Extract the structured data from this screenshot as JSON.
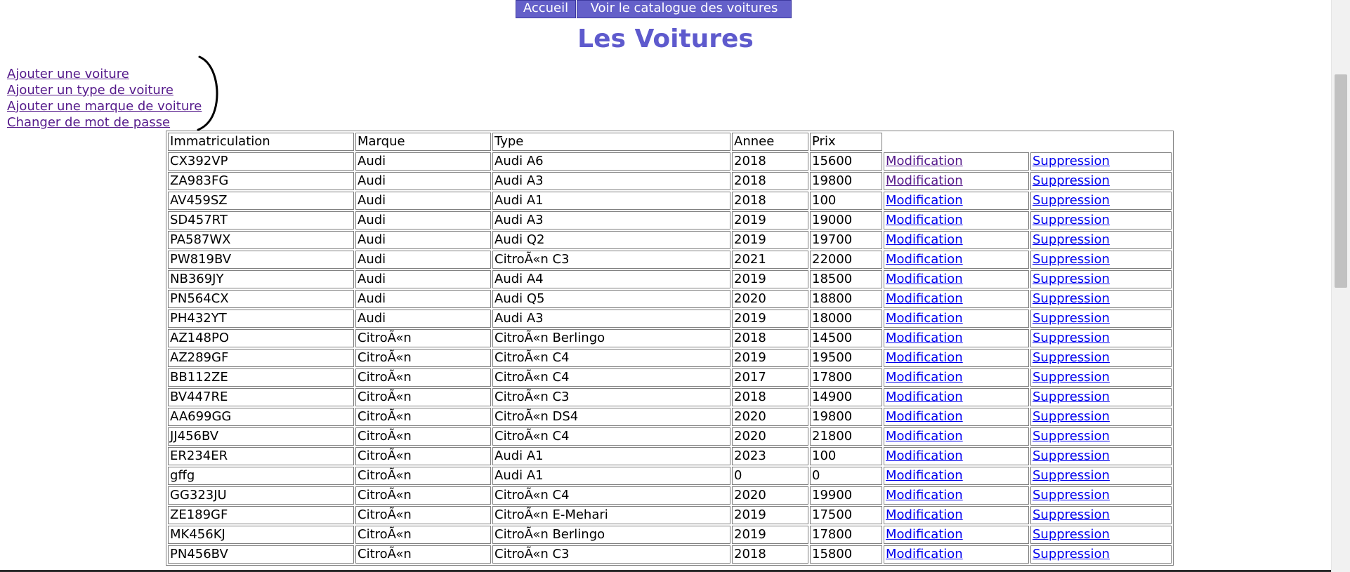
{
  "nav": {
    "home_label": "Accueil",
    "catalog_label": "Voir le catalogue des voitures"
  },
  "page_title": "Les Voitures",
  "links": {
    "add_car": "Ajouter une voiture",
    "add_type": "Ajouter un type de voiture",
    "add_brand": "Ajouter une marque de voiture",
    "change_password": "Changer de mot de passe"
  },
  "table": {
    "headers": [
      "Immatriculation",
      "Marque",
      "Type",
      "Annee",
      "Prix"
    ],
    "edit_label": "Modification",
    "delete_label": "Suppression",
    "rows": [
      [
        "CX392VP",
        "Audi",
        "Audi A6",
        "2018",
        "15600"
      ],
      [
        "ZA983FG",
        "Audi",
        "Audi A3",
        "2018",
        "19800"
      ],
      [
        "AV459SZ",
        "Audi",
        "Audi A1",
        "2018",
        "100"
      ],
      [
        "SD457RT",
        "Audi",
        "Audi A3",
        "2019",
        "19000"
      ],
      [
        "PA587WX",
        "Audi",
        "Audi Q2",
        "2019",
        "19700"
      ],
      [
        "PW819BV",
        "Audi",
        "CitroÃ«n C3",
        "2021",
        "22000"
      ],
      [
        "NB369JY",
        "Audi",
        "Audi A4",
        "2019",
        "18500"
      ],
      [
        "PN564CX",
        "Audi",
        "Audi Q5",
        "2020",
        "18800"
      ],
      [
        "PH432YT",
        "Audi",
        "Audi A3",
        "2019",
        "18000"
      ],
      [
        "AZ148PO",
        "CitroÃ«n",
        "CitroÃ«n Berlingo",
        "2018",
        "14500"
      ],
      [
        "AZ289GF",
        "CitroÃ«n",
        "CitroÃ«n C4",
        "2019",
        "19500"
      ],
      [
        "BB112ZE",
        "CitroÃ«n",
        "CitroÃ«n C4",
        "2017",
        "17800"
      ],
      [
        "BV447RE",
        "CitroÃ«n",
        "CitroÃ«n C3",
        "2018",
        "14900"
      ],
      [
        "AA699GG",
        "CitroÃ«n",
        "CitroÃ«n DS4",
        "2020",
        "19800"
      ],
      [
        "JJ456BV",
        "CitroÃ«n",
        "CitroÃ«n C4",
        "2020",
        "21800"
      ],
      [
        "ER234ER",
        "CitroÃ«n",
        "Audi A1",
        "2023",
        "100"
      ],
      [
        "gffg",
        "CitroÃ«n",
        "Audi A1",
        "0",
        "0"
      ],
      [
        "GG323JU",
        "CitroÃ«n",
        "CitroÃ«n C4",
        "2020",
        "19900"
      ],
      [
        "ZE189GF",
        "CitroÃ«n",
        "CitroÃ«n E-Mehari",
        "2019",
        "17500"
      ],
      [
        "MK456KJ",
        "CitroÃ«n",
        "CitroÃ«n Berlingo",
        "2019",
        "17800"
      ],
      [
        "PN456BV",
        "CitroÃ«n",
        "CitroÃ«n C3",
        "2018",
        "15800"
      ]
    ]
  },
  "colors": {
    "nav_bg": "#6460c9",
    "title": "#5e5acd",
    "link_visited": "#551a8b",
    "link": "#0000ee"
  }
}
